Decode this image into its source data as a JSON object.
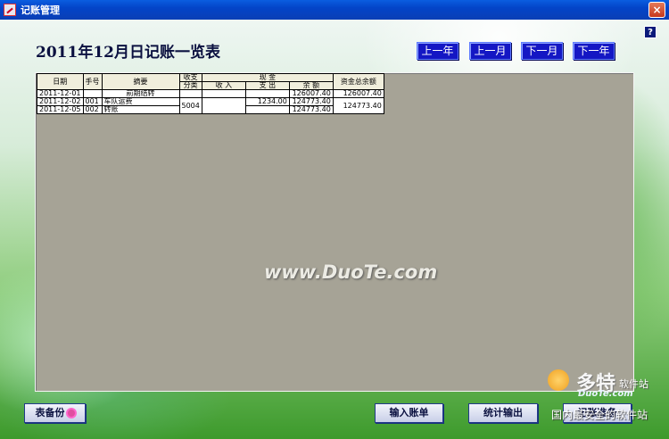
{
  "window": {
    "title": "记账管理",
    "close_label": "×"
  },
  "header": {
    "page_title": "2011年12月日记账一览表",
    "help_label": "?"
  },
  "nav": {
    "prev_year": "上一年",
    "prev_month": "上一月",
    "next_month": "下一月",
    "next_year": "下一年"
  },
  "table": {
    "headers": {
      "date": "日期",
      "voucher_no": "手号",
      "summary": "摘要",
      "category_top": "收支",
      "category_bottom": "分类",
      "cash_group": "现 金",
      "income": "收 入",
      "expense": "支 出",
      "balance": "余 额",
      "total_balance": "资金总余额"
    },
    "rows": [
      {
        "date": "2011-12-01",
        "no": "",
        "summary": "前期结转",
        "category": "",
        "income": "",
        "expense": "",
        "balance": "126007.40",
        "total": "126007.40"
      },
      {
        "date": "2011-12-02",
        "no": "001",
        "summary": "车队运费",
        "category": "5004",
        "income": "",
        "expense": "1234.00",
        "balance": "124773.40",
        "total": "124773.40"
      },
      {
        "date": "2011-12-05",
        "no": "002",
        "summary": "转账",
        "category": "",
        "income": "",
        "expense": "",
        "balance": "124773.40",
        "total": ""
      }
    ]
  },
  "watermark": "www.DuoTe.com",
  "buttons": {
    "backup": "表备份",
    "input_entry": "输入账单",
    "stats_output": "统计输出",
    "ledger_check": "记账准备"
  },
  "site_logo": {
    "brand": "多特",
    "brand_sub": "软件站",
    "domain": "DuoTe.com",
    "tagline": "国内最安全的软件站"
  },
  "colors": {
    "titlebar": "#0344c8",
    "nav_button": "#1417c4",
    "panel": "#a6a396",
    "title_text": "#0b1140"
  }
}
